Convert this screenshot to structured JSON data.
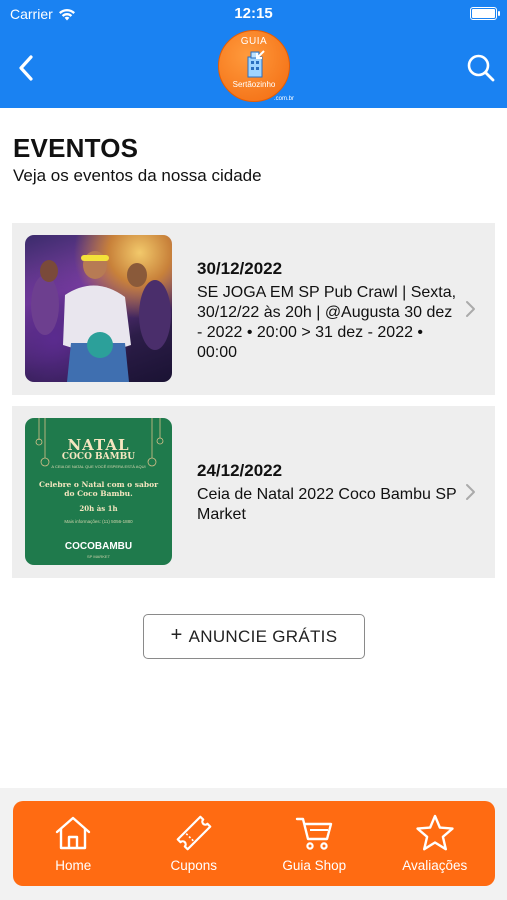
{
  "status_bar": {
    "carrier": "Carrier",
    "time": "12:15",
    "battery_level": 1.0
  },
  "nav": {
    "back_icon": "chevron-left-icon",
    "search_icon": "search-icon",
    "logo_text_top": "GUIA",
    "logo_text_bottom": "Sertãozinho",
    "logo_suffix": ".com.br"
  },
  "page": {
    "title": "EVENTOS",
    "subtitle": "Veja os eventos da nossa cidade"
  },
  "events": [
    {
      "date": "30/12/2022",
      "title": "SE JOGA EM SP Pub Crawl | Sexta, 30/12/22 às 20h | @Augusta 30 dez - 2022 • 20:00 > 31 dez - 2022 • 00:00"
    },
    {
      "date": "24/12/2022",
      "title": "Ceia de Natal 2022 Coco Bambu SP Market",
      "flyer": {
        "heading": "NATAL",
        "heading2": "COCO BAMBU",
        "small": "A CEIA DE NATAL QUE VOCÊ ESPERA ESTÁ AQUI",
        "body": "Celebre o Natal com o sabor do Coco Bambu.",
        "hours": "20h às 1h",
        "info": "Mais informações: (11) 5056-1880",
        "brand": "COCOBAMBU",
        "brand_sub": "SP MARKET"
      }
    }
  ],
  "cta": {
    "icon": "plus-icon",
    "label": "ANUNCIE GRÁTIS"
  },
  "tabbar": {
    "color": "#ff6b12",
    "tabs": [
      {
        "label": "Home",
        "icon": "home-icon"
      },
      {
        "label": "Cupons",
        "icon": "ticket-icon"
      },
      {
        "label": "Guia Shop",
        "icon": "cart-icon"
      },
      {
        "label": "Avaliações",
        "icon": "star-icon"
      }
    ]
  },
  "colors": {
    "header": "#1a82f2",
    "accent": "#ff6b12",
    "card_bg": "#eeeeee"
  }
}
